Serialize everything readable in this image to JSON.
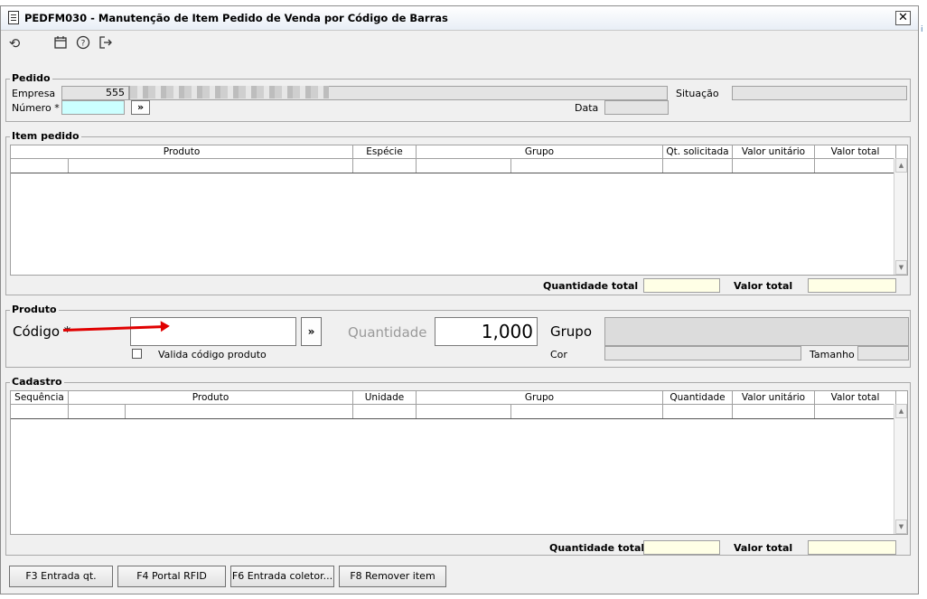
{
  "window": {
    "title": "PEDFM030 - Manutenção de Item Pedido de Venda por Código de Barras",
    "close_glyph": "✕"
  },
  "toolbar": {
    "icons": [
      "refresh-icon",
      "calendar-icon",
      "help-icon",
      "exit-icon"
    ]
  },
  "pedido": {
    "title": "Pedido",
    "empresa_label": "Empresa",
    "empresa_value": "555",
    "numero_label": "Número *",
    "lookup_glyph": "»",
    "situacao_label": "Situação",
    "data_label": "Data"
  },
  "item_pedido": {
    "title": "Item pedido",
    "columns": [
      "Produto",
      "Espécie",
      "Grupo",
      "Qt. solicitada",
      "Valor unitário",
      "Valor total"
    ],
    "qtd_total_label": "Quantidade total",
    "valor_total_label": "Valor total"
  },
  "produto": {
    "title": "Produto",
    "codigo_label": "Código *",
    "lookup_glyph": "»",
    "valida_label": "Valida código produto",
    "quantidade_label": "Quantidade",
    "quantidade_value": "1,000",
    "grupo_label": "Grupo",
    "cor_label": "Cor",
    "tamanho_label": "Tamanho"
  },
  "cadastro": {
    "title": "Cadastro",
    "columns": [
      "Sequência",
      "Produto",
      "Unidade",
      "Grupo",
      "Quantidade",
      "Valor unitário",
      "Valor total"
    ],
    "qtd_total_label": "Quantidade total",
    "valor_total_label": "Valor total"
  },
  "buttons": {
    "f3": "F3 Entrada qt.",
    "f4": "F4 Portal RFID",
    "f6": "F6 Entrada coletor...",
    "f8": "F8 Remover item"
  },
  "colors": {
    "accent_field": "#ccffff",
    "total_field": "#ffffe6",
    "arrow": "#e00000"
  }
}
